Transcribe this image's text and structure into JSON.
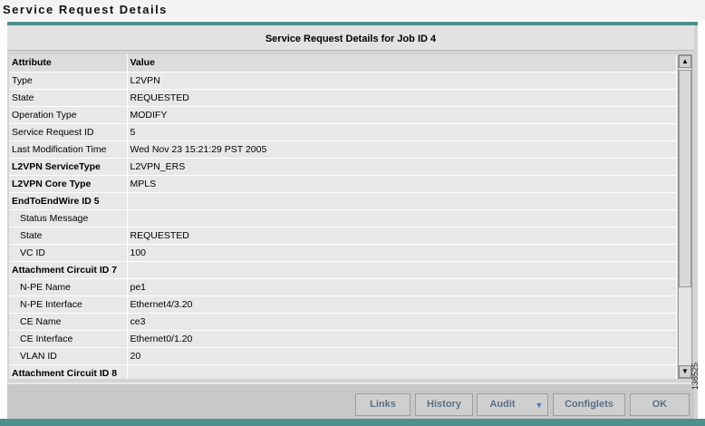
{
  "window": {
    "title": "Service Request Details"
  },
  "panel": {
    "caption": "Service Request Details for Job ID 4"
  },
  "table": {
    "headers": [
      "Attribute",
      "Value"
    ],
    "rows": [
      {
        "attr": "Type",
        "value": "L2VPN"
      },
      {
        "attr": "State",
        "value": "REQUESTED"
      },
      {
        "attr": "Operation Type",
        "value": "MODIFY"
      },
      {
        "attr": "Service Request ID",
        "value": "5"
      },
      {
        "attr": "Last Modification Time",
        "value": "Wed Nov 23 15:21:29 PST 2005"
      },
      {
        "attr": "L2VPN ServiceType",
        "value": "L2VPN_ERS"
      },
      {
        "attr": "L2VPN Core Type",
        "value": "MPLS"
      },
      {
        "attr": "EndToEndWire ID 5",
        "value": ""
      },
      {
        "attr": "Status Message",
        "value": ""
      },
      {
        "attr": "State",
        "value": "REQUESTED"
      },
      {
        "attr": "VC ID",
        "value": "100"
      },
      {
        "attr": "Attachment Circuit ID 7",
        "value": ""
      },
      {
        "attr": "N-PE Name",
        "value": "pe1"
      },
      {
        "attr": "N-PE Interface",
        "value": "Ethernet4/3.20"
      },
      {
        "attr": "CE Name",
        "value": "ce3"
      },
      {
        "attr": "CE Interface",
        "value": "Ethernet0/1.20"
      },
      {
        "attr": "VLAN ID",
        "value": "20"
      },
      {
        "attr": "Attachment Circuit ID 8",
        "value": ""
      }
    ]
  },
  "buttons": {
    "links": "Links",
    "history": "History",
    "audit": "Audit",
    "configlets": "Configlets",
    "ok": "OK"
  },
  "icons": {
    "scroll_up": "scroll-up-arrow-icon",
    "scroll_down": "scroll-down-arrow-icon",
    "audit_dropdown": "dropdown-arrow-icon"
  },
  "figure_id": "138525",
  "colors": {
    "accent_teal": "#4f8f8c",
    "button_text": "#5a6f86",
    "row_bg": "#e8e8e8"
  }
}
